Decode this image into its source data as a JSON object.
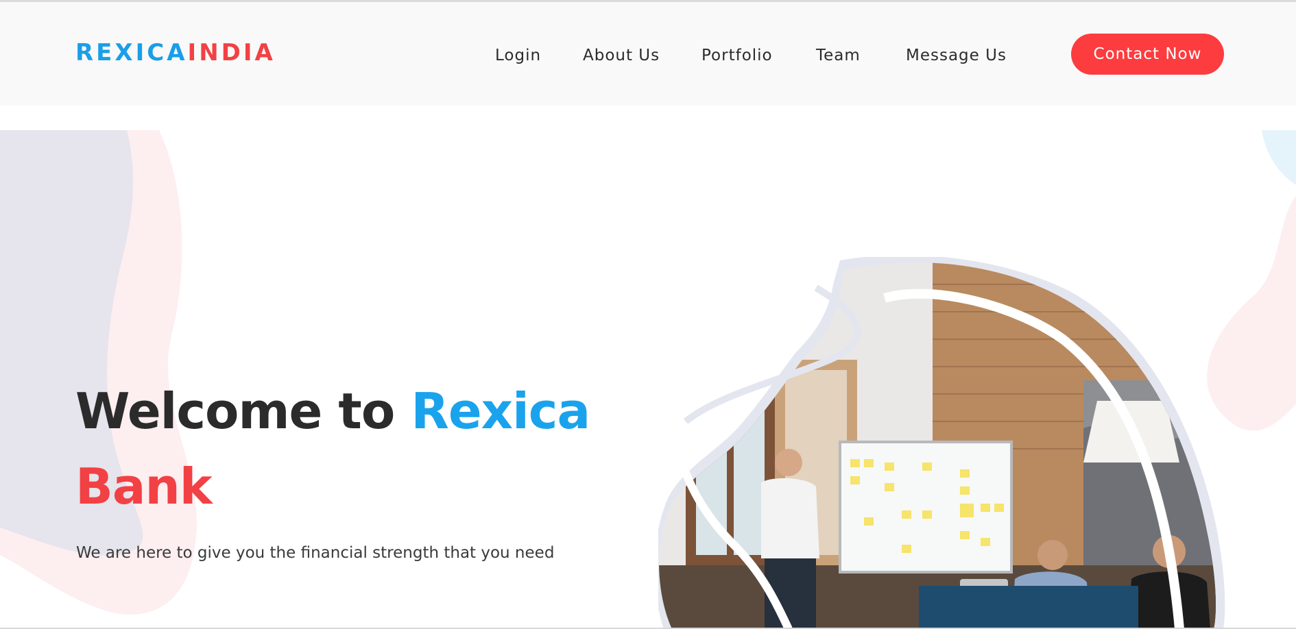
{
  "logo": {
    "part1": "REXICA",
    "part2": "INDIA"
  },
  "nav": {
    "login": "Login",
    "about": "About Us",
    "portfolio": "Portfolio",
    "team": "Team",
    "message": "Message Us",
    "contact_button": "Contact Now"
  },
  "hero": {
    "title_part1": "Welcome to ",
    "title_part2": "Rexica",
    "title_part3": "Bank",
    "subtitle": "We are here to give you the financial strength that you need",
    "image_alt": "Team meeting at whiteboard"
  },
  "colors": {
    "brand_blue": "#1aa3ec",
    "brand_red": "#f24144",
    "button_red": "#fc3c3f",
    "nav_bg": "#f9f9f9"
  }
}
